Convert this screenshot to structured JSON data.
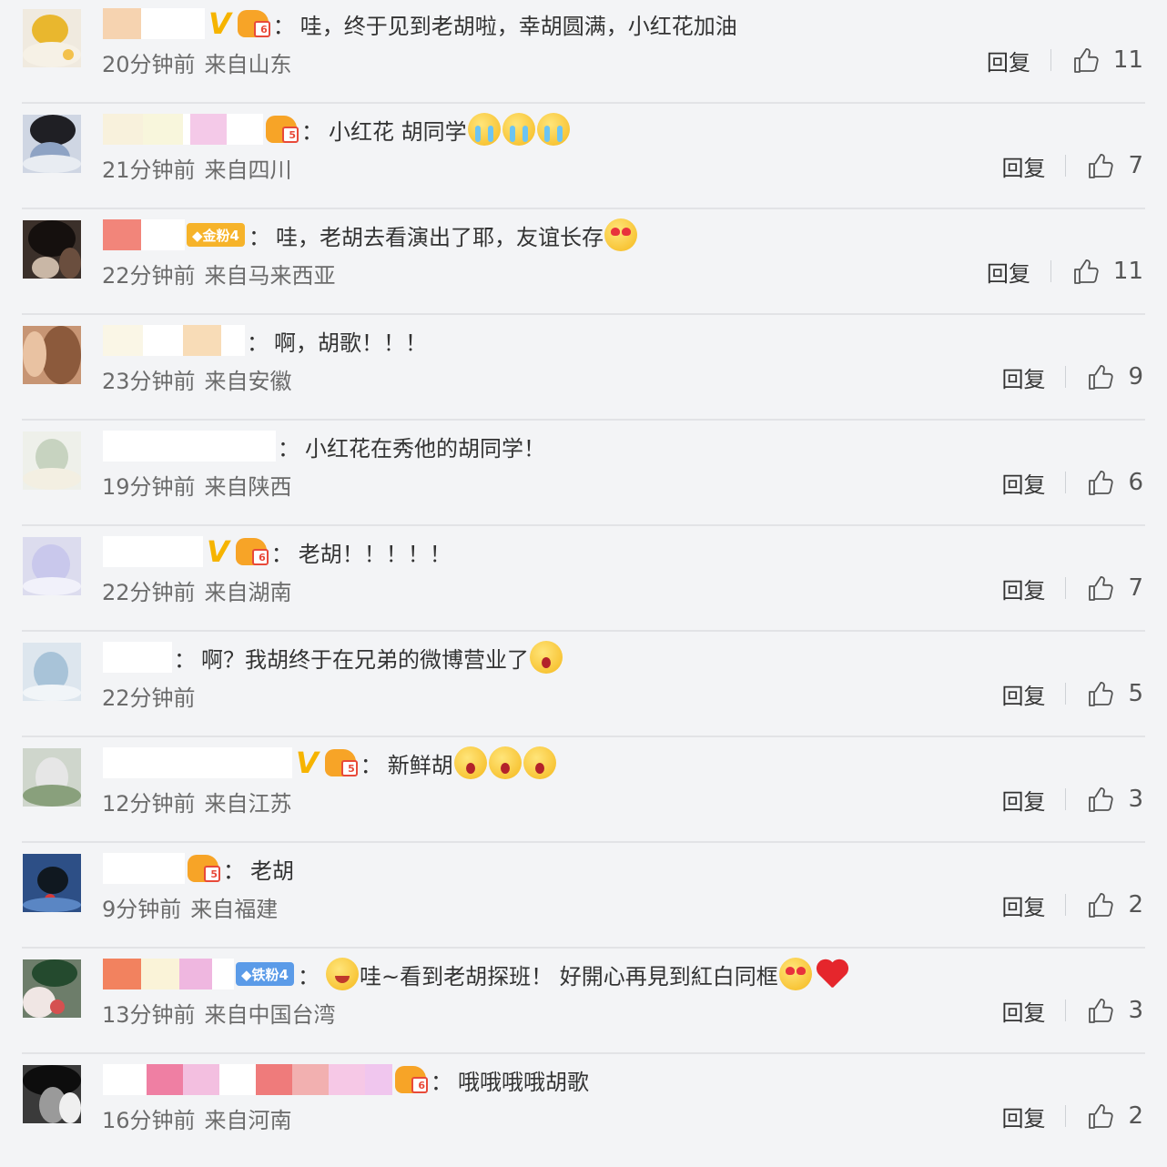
{
  "comments": [
    {
      "name_blocks": [
        {
          "c": "#f6d3b0",
          "w": 42
        },
        {
          "c": "#ffffff",
          "w": 70
        }
      ],
      "v": true,
      "hand": "6",
      "fan": null,
      "text": "哇，终于见到老胡啦，幸胡圆满，小红花加油",
      "emojis": [],
      "time": "20分钟前",
      "location": "来自山东",
      "reply": "回复",
      "likes": "11",
      "avatar": {
        "bg": "#f0eadf",
        "blobs": [
          [
            "#e9b72e",
            10,
            6,
            40,
            34
          ],
          [
            "#f6f1e6",
            0,
            36,
            64,
            28
          ],
          [
            "#f3c14b",
            44,
            44,
            12,
            12
          ]
        ]
      }
    },
    {
      "name_blocks": [
        {
          "c": "#f8f1dc",
          "w": 44
        },
        {
          "c": "#f8f6dc",
          "w": 44
        },
        {
          "c": "#ffffff",
          "w": 8
        },
        {
          "c": "#f4c9e8",
          "w": 40
        },
        {
          "c": "#ffffff",
          "w": 40
        }
      ],
      "v": false,
      "hand": "5",
      "fan": null,
      "text": "小红花 胡同学",
      "emojis": [
        "cry",
        "cry",
        "cry"
      ],
      "time": "21分钟前",
      "location": "来自四川",
      "reply": "回复",
      "likes": "7",
      "avatar": {
        "bg": "#cfd6e3",
        "blobs": [
          [
            "#1f1f24",
            8,
            0,
            50,
            34
          ],
          [
            "#8ea3c4",
            8,
            30,
            44,
            34
          ],
          [
            "#e8ecf2",
            0,
            44,
            64,
            20
          ]
        ]
      }
    },
    {
      "name_blocks": [
        {
          "c": "#f2857a",
          "w": 42
        },
        {
          "c": "#ffffff",
          "w": 48
        }
      ],
      "v": false,
      "hand": null,
      "fan": {
        "label": "◆金粉4",
        "color": "#f6b32a"
      },
      "text": "哇，老胡去看演出了耶，友谊长存",
      "emojis": [
        "heart-eyes"
      ],
      "time": "22分钟前",
      "location": "来自马来西亚",
      "reply": "回复",
      "likes": "11",
      "avatar": {
        "bg": "#3b302a",
        "blobs": [
          [
            "#15100e",
            6,
            0,
            52,
            40
          ],
          [
            "#c9b7a6",
            10,
            40,
            30,
            24
          ],
          [
            "#6a4e3e",
            40,
            30,
            24,
            34
          ]
        ]
      }
    },
    {
      "name_blocks": [
        {
          "c": "#faf6e6",
          "w": 44
        },
        {
          "c": "#ffffff",
          "w": 44
        },
        {
          "c": "#f8dcb7",
          "w": 42
        },
        {
          "c": "#ffffff",
          "w": 26
        }
      ],
      "v": false,
      "hand": null,
      "fan": null,
      "text": "啊，胡歌！！！",
      "emojis": [],
      "time": "23分钟前",
      "location": "来自安徽",
      "reply": "回复",
      "likes": "9",
      "avatar": {
        "bg": "#c79574",
        "blobs": [
          [
            "#8c5a3c",
            20,
            0,
            44,
            64
          ],
          [
            "#e9c2a2",
            0,
            6,
            26,
            50
          ]
        ]
      }
    },
    {
      "name_blocks": [
        {
          "c": "#ffffff",
          "w": 190
        }
      ],
      "v": false,
      "hand": null,
      "fan": null,
      "text": "小红花在秀他的胡同学！",
      "emojis": [],
      "time": "19分钟前",
      "location": "来自陕西",
      "reply": "回复",
      "likes": "6",
      "avatar": {
        "bg": "#eef0ea",
        "blobs": [
          [
            "#c7d3c0",
            14,
            8,
            36,
            40
          ],
          [
            "#f3efe2",
            0,
            40,
            64,
            24
          ]
        ]
      }
    },
    {
      "name_blocks": [
        {
          "c": "#ffffff",
          "w": 110
        }
      ],
      "v": true,
      "hand": "6",
      "fan": null,
      "text": "老胡！！！！！",
      "emojis": [],
      "time": "22分钟前",
      "location": "来自湖南",
      "reply": "回复",
      "likes": "7",
      "avatar": {
        "bg": "#dcdcee",
        "blobs": [
          [
            "#c9c8ec",
            10,
            8,
            42,
            44
          ],
          [
            "#f1f1fa",
            0,
            44,
            64,
            20
          ]
        ]
      }
    },
    {
      "name_blocks": [
        {
          "c": "#ffffff",
          "w": 76
        }
      ],
      "v": false,
      "hand": null,
      "fan": null,
      "text": "啊？我胡终于在兄弟的微博营业了",
      "emojis": [
        "shock"
      ],
      "time": "22分钟前",
      "location": "",
      "reply": "回复",
      "likes": "5",
      "avatar": {
        "bg": "#dde6ee",
        "blobs": [
          [
            "#a8c3d8",
            12,
            10,
            38,
            44
          ],
          [
            "#f1f5f8",
            0,
            46,
            64,
            18
          ]
        ]
      }
    },
    {
      "name_blocks": [
        {
          "c": "#ffffff",
          "w": 208
        }
      ],
      "v": true,
      "hand": "5",
      "fan": null,
      "text": "新鲜胡",
      "emojis": [
        "shock",
        "shock",
        "shock"
      ],
      "time": "12分钟前",
      "location": "来自江苏",
      "reply": "回复",
      "likes": "3",
      "avatar": {
        "bg": "#cfd6cc",
        "blobs": [
          [
            "#e6e6e6",
            14,
            10,
            36,
            44
          ],
          [
            "#89a07c",
            0,
            40,
            64,
            24
          ]
        ]
      }
    },
    {
      "name_blocks": [
        {
          "c": "#ffffff",
          "w": 90
        }
      ],
      "v": false,
      "hand": "5",
      "fan": null,
      "text": "老胡",
      "emojis": [],
      "time": "9分钟前",
      "location": "来自福建",
      "reply": "回复",
      "likes": "2",
      "avatar": {
        "bg": "#2d4f86",
        "blobs": [
          [
            "#101820",
            16,
            14,
            34,
            30
          ],
          [
            "#d63a3a",
            24,
            44,
            12,
            12
          ],
          [
            "#5a86c4",
            0,
            48,
            64,
            16
          ]
        ]
      }
    },
    {
      "name_blocks": [
        {
          "c": "#f2825f",
          "w": 42
        },
        {
          "c": "#faf3d8",
          "w": 42
        },
        {
          "c": "#efb7e0",
          "w": 36
        },
        {
          "c": "#ffffff",
          "w": 24
        }
      ],
      "v": false,
      "hand": null,
      "fan": {
        "label": "◆铁粉4",
        "color": "#5b9be8"
      },
      "text": "哇~看到老胡探班！ 好開心再見到紅白同框",
      "emojis_before": [
        "smile"
      ],
      "emojis": [
        "heart-eyes"
      ],
      "heart": true,
      "time": "13分钟前",
      "location": "来自中国台湾",
      "reply": "回复",
      "likes": "3",
      "avatar": {
        "bg": "#6d7d6a",
        "blobs": [
          [
            "#244a2e",
            10,
            0,
            50,
            30
          ],
          [
            "#f0e6e4",
            0,
            30,
            36,
            34
          ],
          [
            "#d55050",
            30,
            44,
            16,
            16
          ]
        ]
      }
    },
    {
      "name_blocks": [
        {
          "c": "#ffffff",
          "w": 48
        },
        {
          "c": "#ef7fa3",
          "w": 40
        },
        {
          "c": "#f3bfe0",
          "w": 40
        },
        {
          "c": "#ffffff",
          "w": 40
        },
        {
          "c": "#ef7b7b",
          "w": 40
        },
        {
          "c": "#f2b0b0",
          "w": 40
        },
        {
          "c": "#f6c8e6",
          "w": 40
        },
        {
          "c": "#f0c6ee",
          "w": 30
        }
      ],
      "v": false,
      "hand": "6",
      "fan": null,
      "text": "哦哦哦哦胡歌",
      "emojis": [],
      "time": "16分钟前",
      "location": "来自河南",
      "reply": "回复",
      "likes": "2",
      "avatar": {
        "bg": "#3a3a3a",
        "blobs": [
          [
            "#0d0d0d",
            0,
            0,
            64,
            34
          ],
          [
            "#9a9a9a",
            18,
            24,
            30,
            40
          ],
          [
            "#efefef",
            40,
            30,
            24,
            34
          ]
        ]
      }
    }
  ]
}
